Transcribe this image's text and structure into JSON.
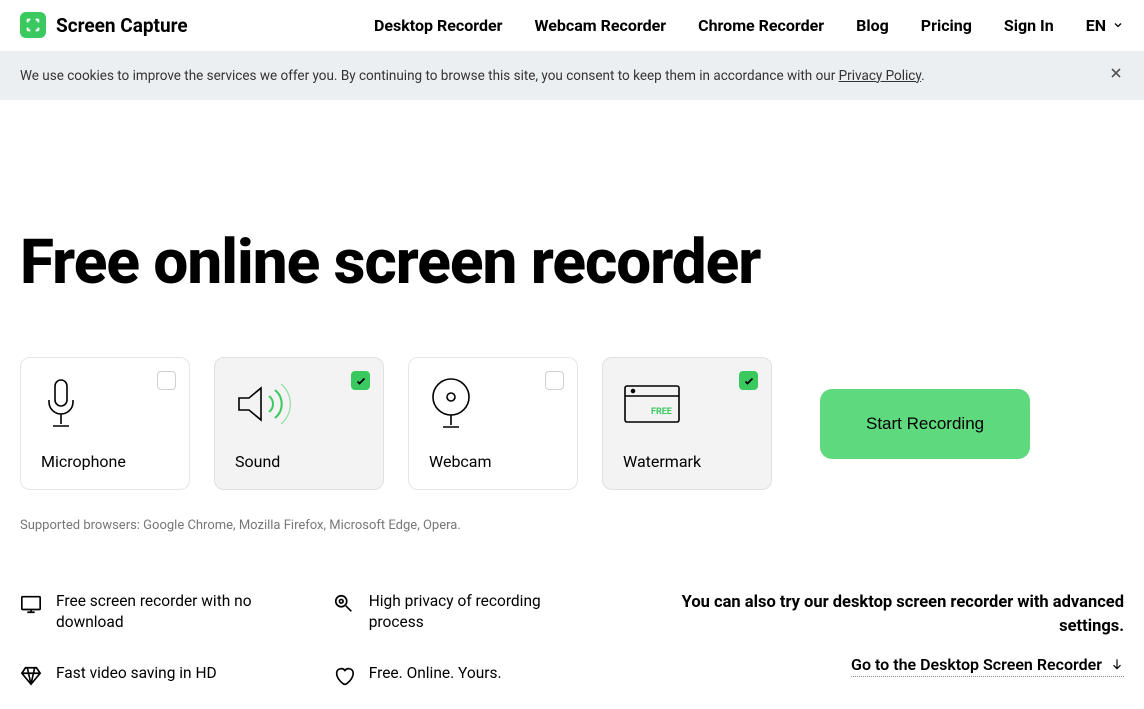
{
  "brand": {
    "name": "Screen Capture"
  },
  "nav": {
    "items": [
      "Desktop Recorder",
      "Webcam Recorder",
      "Chrome Recorder",
      "Blog",
      "Pricing",
      "Sign In"
    ],
    "lang": "EN"
  },
  "cookie": {
    "text_before": "We use cookies to improve the services we offer you. By continuing to browse this site, you consent to keep them in accordance with our ",
    "link": "Privacy Policy",
    "text_after": "."
  },
  "hero": {
    "title": "Free online screen recorder"
  },
  "options": [
    {
      "label": "Microphone",
      "checked": false
    },
    {
      "label": "Sound",
      "checked": true
    },
    {
      "label": "Webcam",
      "checked": false
    },
    {
      "label": "Watermark",
      "checked": true
    }
  ],
  "cta": {
    "start": "Start Recording"
  },
  "supported": "Supported browsers: Google Chrome, Mozilla Firefox, Microsoft Edge, Opera.",
  "features": {
    "col1": [
      "Free screen recorder with no download",
      "Fast video saving in HD"
    ],
    "col2": [
      "High privacy of recording process",
      "Free. Online. Yours."
    ]
  },
  "desktop_cta": {
    "text": "You can also try our desktop screen recorder with advanced settings.",
    "link": "Go to the Desktop Screen Recorder"
  }
}
